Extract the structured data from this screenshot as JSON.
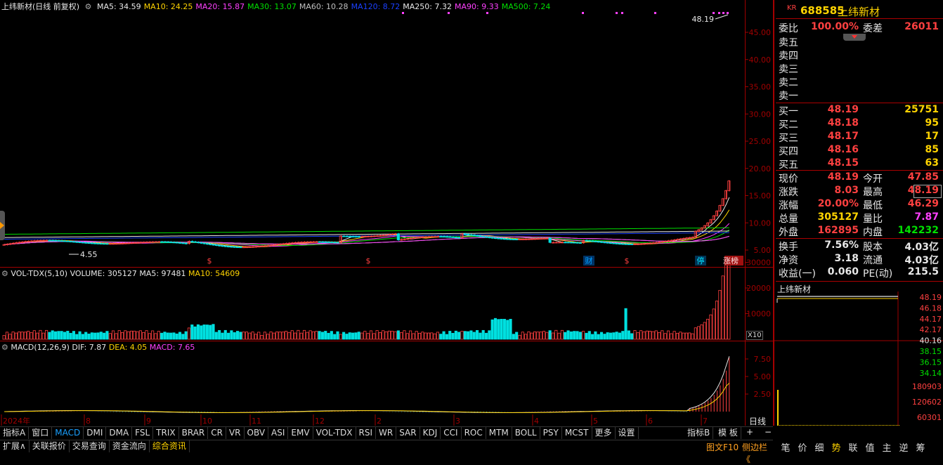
{
  "main": {
    "title": "上纬新材(日线 前复权)",
    "ma_legend": [
      {
        "label": "MA5: 34.59",
        "color": "#e8e8e8"
      },
      {
        "label": "MA10: 24.25",
        "color": "#ffd400"
      },
      {
        "label": "MA20: 15.87",
        "color": "#ff40ff"
      },
      {
        "label": "MA30: 13.07",
        "color": "#00e000"
      },
      {
        "label": "MA60: 10.28",
        "color": "#c0c0c0"
      },
      {
        "label": "MA120: 8.72",
        "color": "#1a40ff"
      },
      {
        "label": "MA250: 7.32",
        "color": "#e8e8e8"
      },
      {
        "label": "MA90: 9.33",
        "color": "#ff40ff"
      },
      {
        "label": "MA500: 7.24",
        "color": "#00e000"
      }
    ],
    "price_ticks": [
      "45.00",
      "40.00",
      "35.00",
      "30.00",
      "25.00",
      "20.00",
      "15.00",
      "10.00",
      "5.00"
    ],
    "high_label": "48.19",
    "low_label": "4.55",
    "markers": {
      "cai": "财",
      "s1": "$",
      "s2": "$",
      "s3": "$",
      "ting": "停",
      "zhangbang": "涨榜"
    }
  },
  "volume": {
    "title": "VOL-TDX(5,10)",
    "volume": "VOLUME: 305127",
    "ma5": "MA5: 97481",
    "ma10": "MA10: 54609",
    "ticks": [
      "30000",
      "20000",
      "10000"
    ],
    "unit": "X10"
  },
  "macd": {
    "title": "MACD(12,26,9)",
    "dif": "DIF: 7.87",
    "dea": "DEA: 4.05",
    "macd": "MACD: 7.65",
    "ticks": [
      "7.50",
      "5.00",
      "2.50"
    ]
  },
  "x_axis": {
    "labels": [
      "2024年",
      "8",
      "9",
      "10",
      "11",
      "12",
      "2",
      "3",
      "4",
      "5",
      "6",
      "7"
    ]
  },
  "indicator_tabs": [
    "指标A",
    "窗口",
    "MACD",
    "DMI",
    "DMA",
    "FSL",
    "TRIX",
    "BRAR",
    "CR",
    "VR",
    "OBV",
    "ASI",
    "EMV",
    "VOL-TDX",
    "RSI",
    "WR",
    "SAR",
    "KDJ",
    "CCI",
    "ROC",
    "MTM",
    "BOLL",
    "PSY",
    "MCST",
    "更多",
    "设置"
  ],
  "indicator_tabs_right": {
    "zhibiao_b": "指标B",
    "muban": "模 板"
  },
  "bottom_tabs": [
    "扩展∧",
    "关联报价",
    "交易查询",
    "资金流向",
    "综合资讯"
  ],
  "right_panel": {
    "badge": "KR",
    "code": "688585",
    "name": "上纬新材",
    "weibi_label": "委比",
    "weibi": "100.00%",
    "weicha_label": "委差",
    "weicha": "26011",
    "asks": [
      {
        "label": "卖五",
        "price": "",
        "vol": ""
      },
      {
        "label": "卖四",
        "price": "",
        "vol": ""
      },
      {
        "label": "卖三",
        "price": "",
        "vol": ""
      },
      {
        "label": "卖二",
        "price": "",
        "vol": ""
      },
      {
        "label": "卖一",
        "price": "",
        "vol": ""
      }
    ],
    "bids": [
      {
        "label": "买一",
        "price": "48.19",
        "vol": "25751"
      },
      {
        "label": "买二",
        "price": "48.18",
        "vol": "95"
      },
      {
        "label": "买三",
        "price": "48.17",
        "vol": "17"
      },
      {
        "label": "买四",
        "price": "48.16",
        "vol": "85"
      },
      {
        "label": "买五",
        "price": "48.15",
        "vol": "63"
      }
    ],
    "stats": [
      {
        "l1": "现价",
        "v1": "48.19",
        "c1": "red",
        "l2": "今开",
        "v2": "47.85",
        "c2": "red"
      },
      {
        "l1": "涨跌",
        "v1": "8.03",
        "c1": "red",
        "l2": "最高",
        "v2": "48.19",
        "c2": "red"
      },
      {
        "l1": "涨幅",
        "v1": "20.00%",
        "c1": "red",
        "l2": "最低",
        "v2": "46.29",
        "c2": "red"
      },
      {
        "l1": "总量",
        "v1": "305127",
        "c1": "yellow",
        "l2": "量比",
        "v2": "7.87",
        "c2": "magenta"
      },
      {
        "l1": "外盘",
        "v1": "162895",
        "c1": "red",
        "l2": "内盘",
        "v2": "142232",
        "c2": "green"
      }
    ],
    "stats2": [
      {
        "l1": "换手",
        "v1": "7.56%",
        "l2": "股本",
        "v2": "4.03亿"
      },
      {
        "l1": "净资",
        "v1": "3.18",
        "l2": "流通",
        "v2": "4.03亿"
      },
      {
        "l1": "收益(一)",
        "v1": "0.060",
        "l2": "PE(动)",
        "v2": "215.5"
      }
    ],
    "mini_title": "上纬新材",
    "mini_price_ticks": [
      "48.19",
      "46.18",
      "44.17",
      "42.17",
      "40.16",
      "38.15",
      "36.15",
      "34.14"
    ],
    "mini_vol_ticks": [
      "180903",
      "120602",
      "60301"
    ],
    "period": "日线",
    "plus": "+",
    "minus": "−",
    "f10": "图文F10",
    "sidebar": "侧边栏《",
    "bottom_tabs": [
      "笔",
      "价",
      "细",
      "势",
      "联",
      "值",
      "主",
      "逆",
      "筹"
    ]
  }
}
